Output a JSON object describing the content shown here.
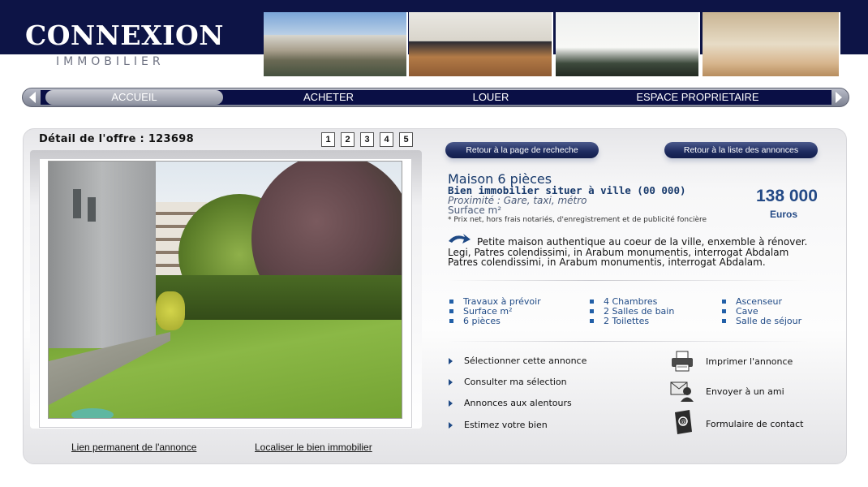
{
  "brand": {
    "name": "CONNEXION",
    "tagline": "IMMOBILIER"
  },
  "nav": {
    "items": [
      {
        "label": "ACCUEIL",
        "active": true
      },
      {
        "label": "ACHETER"
      },
      {
        "label": "LOUER"
      },
      {
        "label": "ESPACE PROPRIETAIRE"
      }
    ]
  },
  "offer": {
    "title": "Détail de l'offre : 123698",
    "pages": [
      "1",
      "2",
      "3",
      "4",
      "5"
    ],
    "links": {
      "permalink": "Lien permanent de l'annonce",
      "locate": "Localiser le bien immobilier"
    }
  },
  "buttons": {
    "back_search": "Retour à la page de recheche",
    "back_list": "Retour à la liste des annonces"
  },
  "property": {
    "title": "Maison 6 pièces",
    "location": "Bien immobilier situer à ville (00 000)",
    "proximity": "Proximité : Gare, taxi, métro",
    "surface": "Surface m²",
    "note": "* Prix net, hors frais notariés, d'enregistrement et de publicité foncière",
    "price": "138 000",
    "currency": "Euros",
    "description": "Petite maison authentique au coeur de la ville, enxemble à rénover. Legi, Patres colendissimi, in Arabum monumentis, interrogat  Abdalam Patres colendissimi, in Arabum monumentis, interrogat  Abdalam."
  },
  "features": {
    "col1": [
      "Travaux à prévoir",
      "Surface m²",
      "6 pièces"
    ],
    "col2": [
      "4 Chambres",
      "2 Salles de bain",
      "2 Toilettes"
    ],
    "col3": [
      "Ascenseur",
      "Cave",
      "Salle de séjour"
    ]
  },
  "actions": [
    "Sélectionner cette annonce",
    "Consulter ma sélection",
    "Annonces aux alentours",
    "Estimez votre bien"
  ],
  "tools": [
    {
      "label": "Imprimer l'annonce",
      "icon": "printer-icon"
    },
    {
      "label": "Envoyer à un ami",
      "icon": "mail-user-icon"
    },
    {
      "label": "Formulaire de contact",
      "icon": "contact-form-icon"
    }
  ],
  "colors": {
    "navy": "#0d1446",
    "accent_blue": "#244a86",
    "text_blue": "#17396b"
  }
}
